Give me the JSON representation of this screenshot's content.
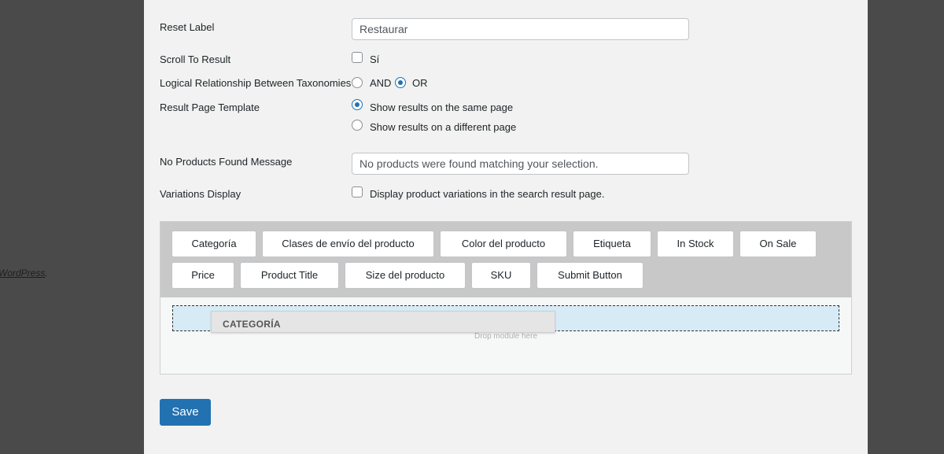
{
  "background": {
    "link_text": "WordPress",
    "link_suffix": "."
  },
  "form": {
    "reset_label": {
      "label": "Reset Label",
      "value": "Restaurar"
    },
    "scroll_to_result": {
      "label": "Scroll To Result",
      "option": "Sí",
      "checked": false
    },
    "logical_relationship": {
      "label": "Logical Relationship Between Taxonomies",
      "options": [
        "AND",
        "OR"
      ],
      "selected": "OR"
    },
    "result_page_template": {
      "label": "Result Page Template",
      "options": [
        "Show results on the same page",
        "Show results on a different page"
      ],
      "selected": "Show results on the same page"
    },
    "no_products_message": {
      "label": "No Products Found Message",
      "value": "No products were found matching your selection."
    },
    "variations_display": {
      "label": "Variations Display",
      "option": "Display product variations in the search result page.",
      "checked": false
    }
  },
  "builder": {
    "modules": [
      "Categoría",
      "Clases de envío del producto",
      "Color del producto",
      "Etiqueta",
      "In Stock",
      "On Sale",
      "Price",
      "Product Title",
      "Size del producto",
      "SKU",
      "Submit Button"
    ],
    "dragged_module": "CATEGORÍA",
    "drop_hint": "Drop module here"
  },
  "actions": {
    "save_label": "Save"
  },
  "colors": {
    "accent": "#2271b1",
    "drop_zone": "#d6ebf5",
    "module_bar": "#c8c8c8"
  }
}
